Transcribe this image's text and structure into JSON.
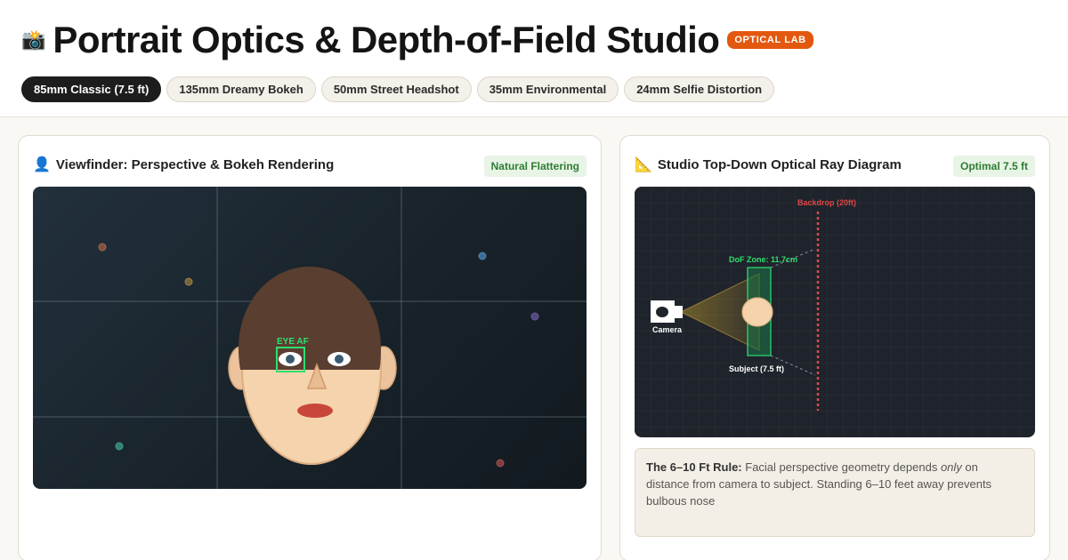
{
  "header": {
    "emoji": "📸",
    "title": "Portrait Optics & Depth-of-Field Studio",
    "badge": "OPTICAL LAB"
  },
  "tabs": [
    {
      "label": "85mm Classic (7.5 ft)",
      "active": true
    },
    {
      "label": "135mm Dreamy Bokeh",
      "active": false
    },
    {
      "label": "50mm Street Headshot",
      "active": false
    },
    {
      "label": "35mm Environmental",
      "active": false
    },
    {
      "label": "24mm Selfie Distortion",
      "active": false
    }
  ],
  "viewfinder": {
    "icon": "person-icon",
    "emoji": "👤",
    "title": "Viewfinder: Perspective & Bokeh Rendering",
    "badge": "Natural Flattering",
    "eye_af_label": "EYE AF"
  },
  "diagram": {
    "icon": "triangle-ruler-icon",
    "emoji": "📐",
    "title": "Studio Top-Down Optical Ray Diagram",
    "badge": "Optimal 7.5 ft",
    "backdrop_label": "Backdrop (20ft)",
    "dof_label": "DoF Zone: 11.7cm",
    "camera_label": "Camera",
    "subject_label": "Subject (7.5 ft)"
  },
  "rule": {
    "heading": "The 6–10 Ft Rule:",
    "text_a": " Facial perspective geometry depends ",
    "text_em": "only",
    "text_b": " on distance from camera to subject. Standing 6–10 feet away prevents bulbous nose"
  },
  "colors": {
    "accent": "#e2580f",
    "tab_active": "#1d1d1d",
    "af_green": "#2ee06f",
    "backdrop_red": "#e04848"
  }
}
